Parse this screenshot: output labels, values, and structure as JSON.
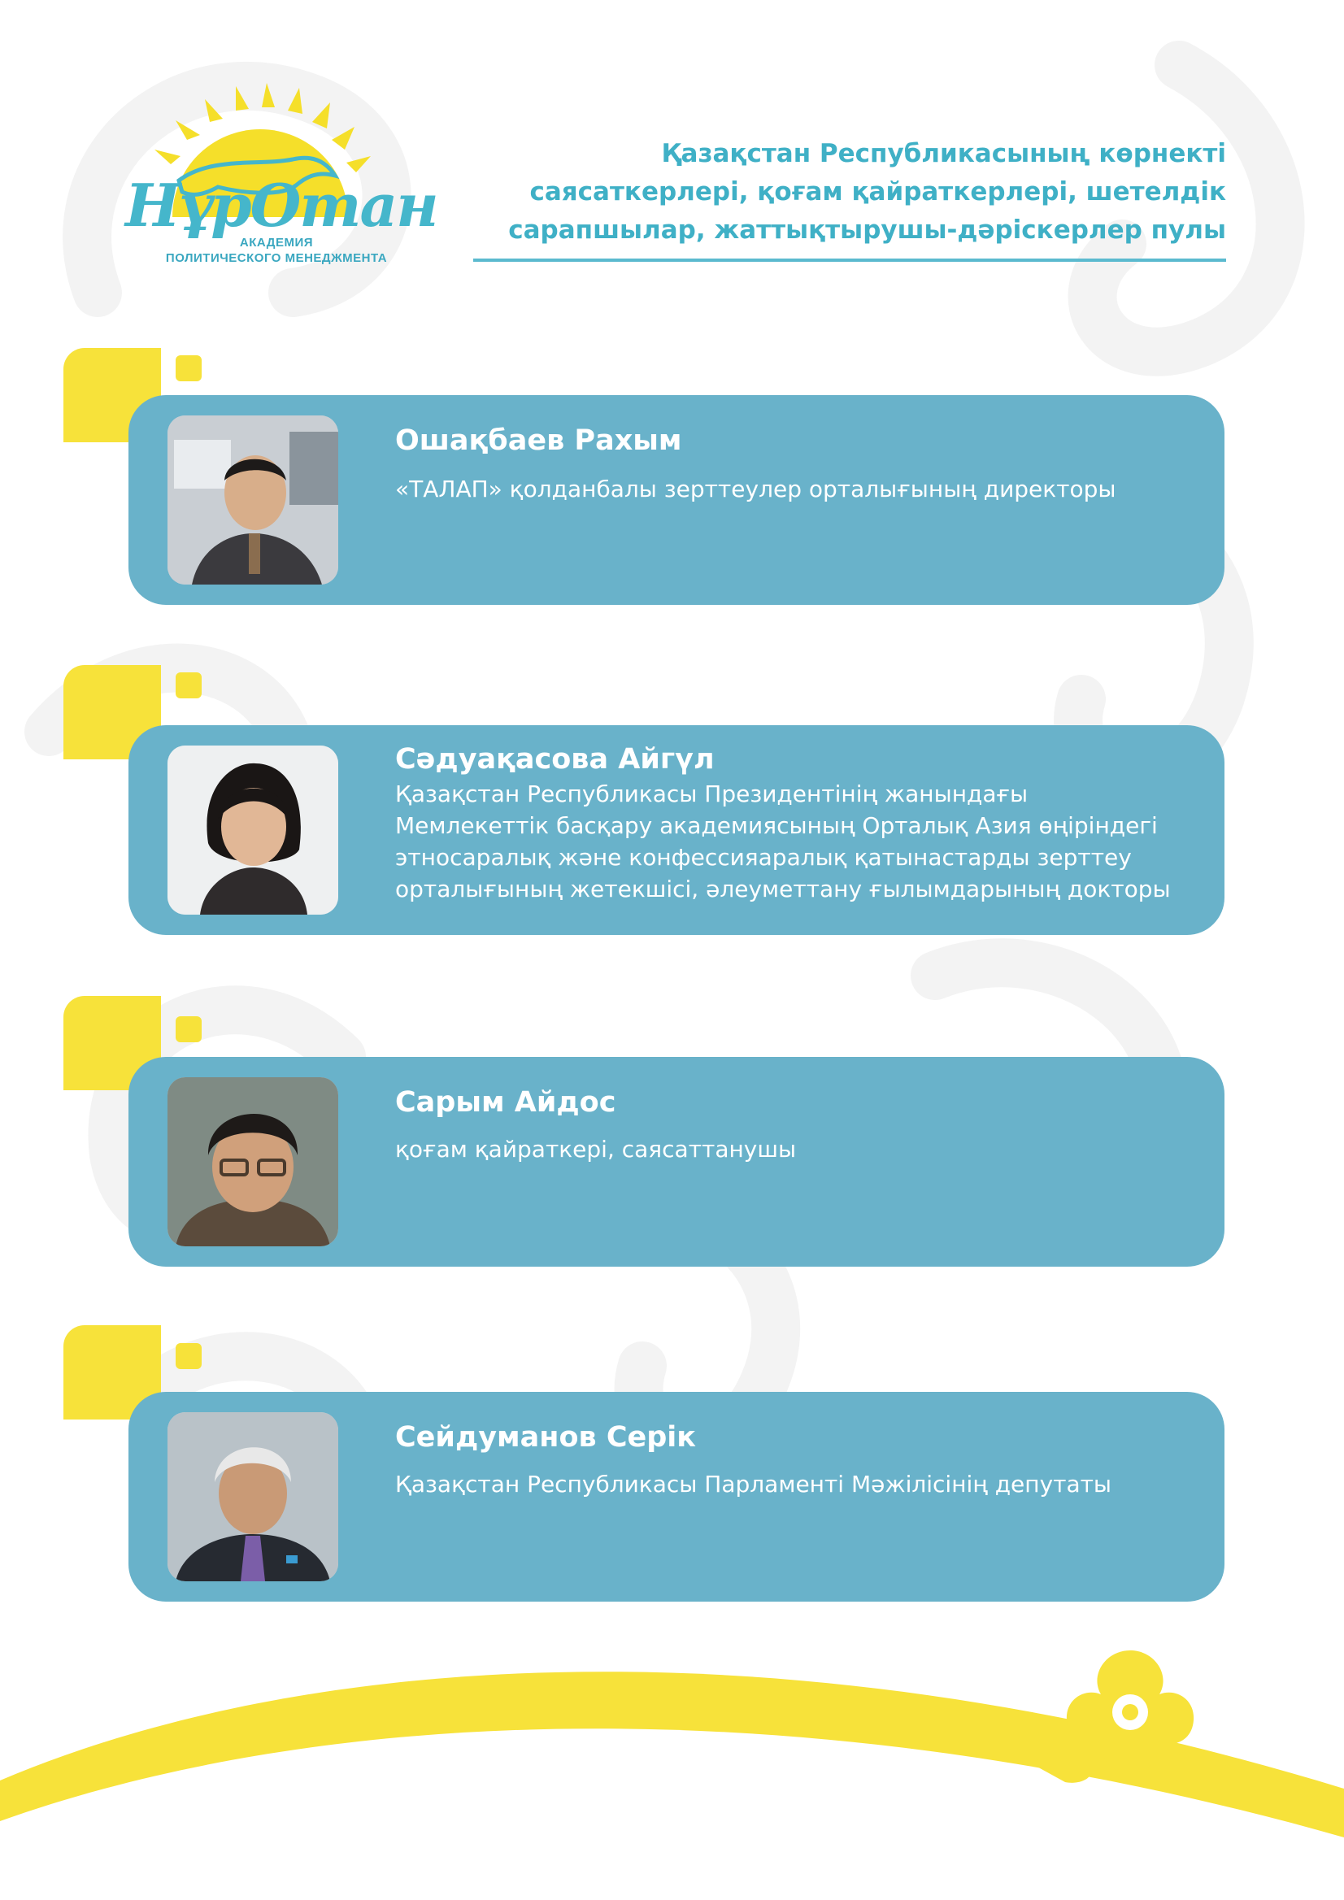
{
  "logo": {
    "script_text": "НұрОтан",
    "line1": "АКАДЕМИЯ",
    "line2": "ПОЛИТИЧЕСКОГО МЕНЕДЖМЕНТА",
    "colors": {
      "sun": "#f5df2a",
      "brand": "#45b6cb"
    },
    "icon": "snow-leopard-sun-icon"
  },
  "header": {
    "title_lines": [
      "Қазақстан Республикасының көрнекті",
      "саясаткерлері, қоғам қайраткерлері, шетелдік",
      "сарапшылар, жаттықтырушы-дәріскерлер пулы"
    ],
    "color": "#3fb0c6"
  },
  "people": [
    {
      "name": "Ошақбаев Рахым",
      "description_lines": [
        "«ТАЛАП» қолданбалы зерттеулер орталығының директоры"
      ]
    },
    {
      "name": "Сәдуақасова Айгүл",
      "description_lines": [
        "Қазақстан Республикасы Президентінің жанындағы",
        "Мемлекеттік басқару академиясының Орталық Азия өңіріндегі",
        "этносаралық және конфессияаралық қатынастарды зерттеу",
        "орталығының жетекшісі, әлеуметтану ғылымдарының докторы"
      ]
    },
    {
      "name": "Сарым Айдос",
      "description_lines": [
        "қоғам қайраткері, саясаттанушы"
      ]
    },
    {
      "name": "Сейдуманов Серік",
      "description_lines": [
        "Қазақстан Республикасы Парламенті Мәжілісінің депутаты"
      ]
    }
  ],
  "colors": {
    "card": "#69b2ca",
    "accent_yellow": "#f7e23a",
    "text_on_card": "#ffffff"
  }
}
